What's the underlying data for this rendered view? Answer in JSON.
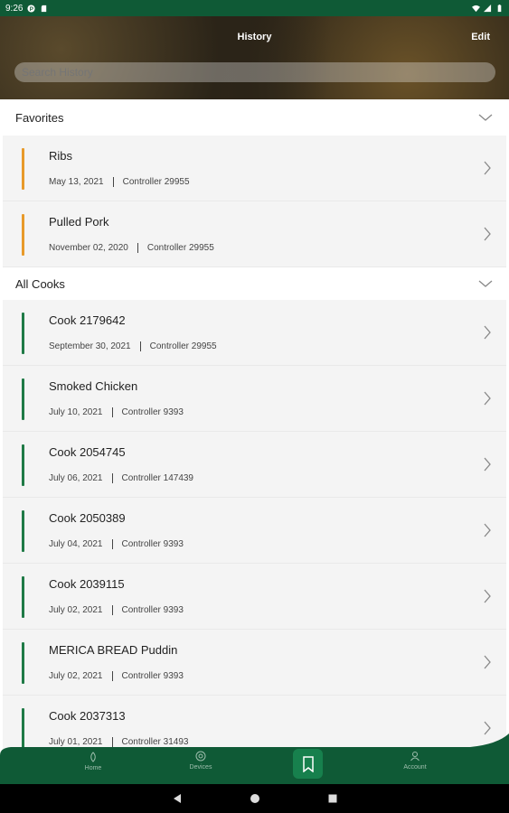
{
  "status_bar": {
    "time": "9:26"
  },
  "header": {
    "title": "History",
    "edit_label": "Edit"
  },
  "search": {
    "placeholder": "Search History"
  },
  "favorites": {
    "label": "Favorites",
    "items": [
      {
        "name": "Ribs",
        "date": "May 13, 2021",
        "controller": "Controller 29955"
      },
      {
        "name": "Pulled Pork",
        "date": "November 02, 2020",
        "controller": "Controller 29955"
      }
    ]
  },
  "all_cooks": {
    "label": "All Cooks",
    "items": [
      {
        "name": "Cook 2179642",
        "date": "September 30, 2021",
        "controller": "Controller 29955"
      },
      {
        "name": "Smoked Chicken",
        "date": "July 10, 2021",
        "controller": "Controller 9393"
      },
      {
        "name": "Cook 2054745",
        "date": "July 06, 2021",
        "controller": "Controller 147439"
      },
      {
        "name": "Cook 2050389",
        "date": "July 04, 2021",
        "controller": "Controller 9393"
      },
      {
        "name": "Cook 2039115",
        "date": "July 02, 2021",
        "controller": "Controller 9393"
      },
      {
        "name": "MERICA BREAD Puddin",
        "date": "July 02, 2021",
        "controller": "Controller 9393"
      },
      {
        "name": "Cook 2037313",
        "date": "July 01, 2021",
        "controller": "Controller 31493"
      }
    ]
  },
  "bottom_nav": {
    "home": "Home",
    "devices": "Devices",
    "account": "Account"
  },
  "colors": {
    "brand_green": "#0f5a36",
    "accent_orange": "#e89a2a",
    "bar_green": "#1f7a46"
  }
}
